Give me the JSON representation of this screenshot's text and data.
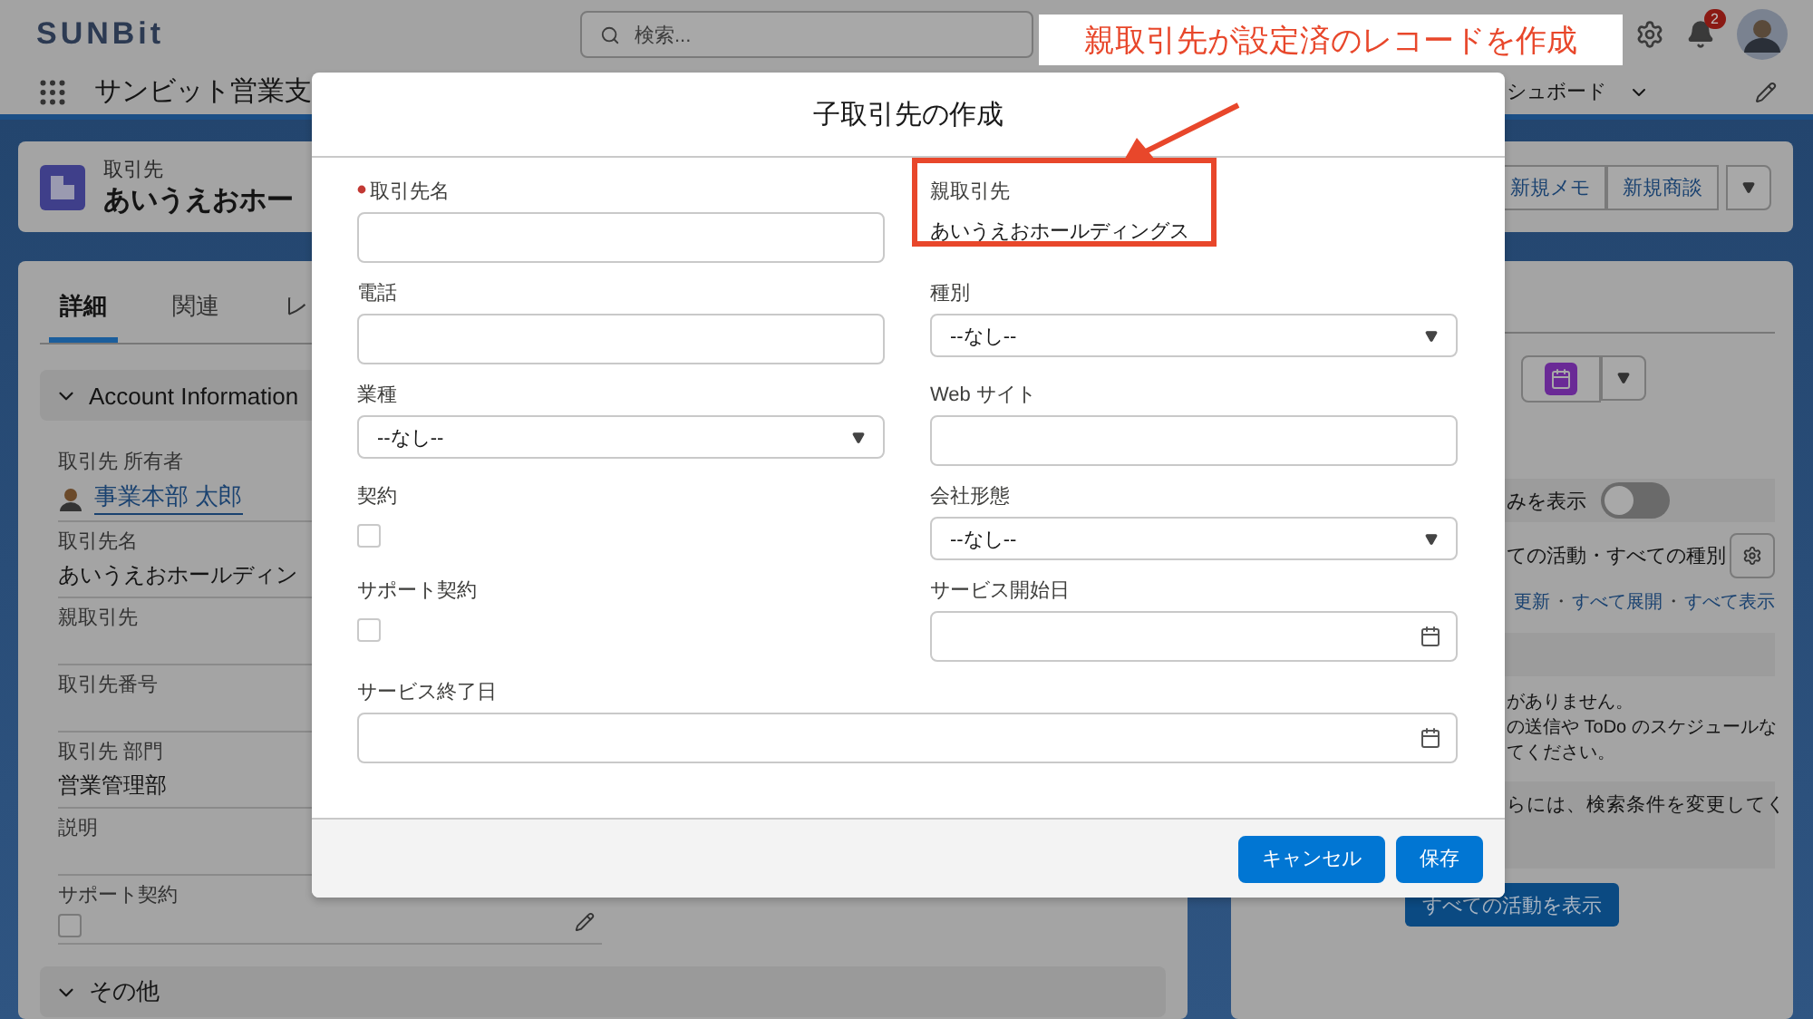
{
  "header": {
    "logo": "SUNBit",
    "search_placeholder": "検索...",
    "notification_count": "2"
  },
  "nav": {
    "app_name": "サンビット営業支",
    "tab_partial": "シュボード"
  },
  "record": {
    "type_label": "取引先",
    "name": "あいうえおホー"
  },
  "detail_tabs": [
    {
      "label": "詳細",
      "selected": true
    },
    {
      "label": "関連",
      "selected": false
    },
    {
      "label": "レ",
      "selected": false
    }
  ],
  "section": {
    "title": "Account Information",
    "expanded": true
  },
  "detail_fields": [
    {
      "label": "取引先 所有者",
      "kind": "user",
      "value": "事業本部 太郎"
    },
    {
      "label": "取引先名",
      "kind": "text",
      "value": "あいうえおホールディン"
    },
    {
      "label": "親取引先",
      "kind": "text"
    },
    {
      "label": "取引先番号",
      "kind": "text"
    },
    {
      "label": "取引先 部門",
      "kind": "text",
      "value": "営業管理部"
    },
    {
      "label": "説明",
      "kind": "text"
    },
    {
      "label": "サポート契約",
      "kind": "checkbox",
      "checked": false
    }
  ],
  "section2": {
    "title": "その他",
    "expanded": true
  },
  "actions": [
    "新規メモ",
    "新規商談"
  ],
  "activity": {
    "toggle_label": "みを表示",
    "toggle_on": false,
    "filter_text": "ての活動・すべての種別",
    "links": [
      "更新",
      "すべて展開",
      "すべて表示"
    ],
    "link_separator": "・",
    "message_lines": [
      "がありません。",
      "の送信や ToDo のスケジュールな",
      "てください。"
    ],
    "hint": "らには、検索条件を変更してく",
    "show_all_button": "すべての活動を表示"
  },
  "modal": {
    "title": "子取引先の作成",
    "fields": [
      {
        "label": "取引先名",
        "kind": "text",
        "required": true,
        "highlighted": false
      },
      {
        "label": "親取引先",
        "kind": "readonly",
        "value": "あいうえおホールディングス",
        "required": false,
        "highlighted": true
      },
      {
        "label": "電話",
        "kind": "text",
        "required": false,
        "highlighted": false
      },
      {
        "label": "種別",
        "kind": "select",
        "value": "--なし--",
        "required": false,
        "highlighted": false
      },
      {
        "label": "業種",
        "kind": "select",
        "value": "--なし--",
        "required": false,
        "highlighted": false
      },
      {
        "label": "Web サイト",
        "kind": "text",
        "required": false,
        "highlighted": false
      },
      {
        "label": "契約",
        "kind": "checkbox",
        "checked": false,
        "required": false,
        "highlighted": false
      },
      {
        "label": "会社形態",
        "kind": "select",
        "value": "--なし--",
        "required": false,
        "highlighted": false
      },
      {
        "label": "サポート契約",
        "kind": "checkbox",
        "checked": false,
        "required": false,
        "highlighted": false
      },
      {
        "label": "サービス開始日",
        "kind": "date",
        "required": false,
        "highlighted": false
      },
      {
        "label": "サービス終了日",
        "kind": "date",
        "wide": true,
        "required": false,
        "highlighted": false
      }
    ],
    "buttons": [
      {
        "label": "キャンセル"
      },
      {
        "label": "保存"
      }
    ]
  },
  "annotation": {
    "callout": "親取引先が設定済のレコードを作成"
  }
}
